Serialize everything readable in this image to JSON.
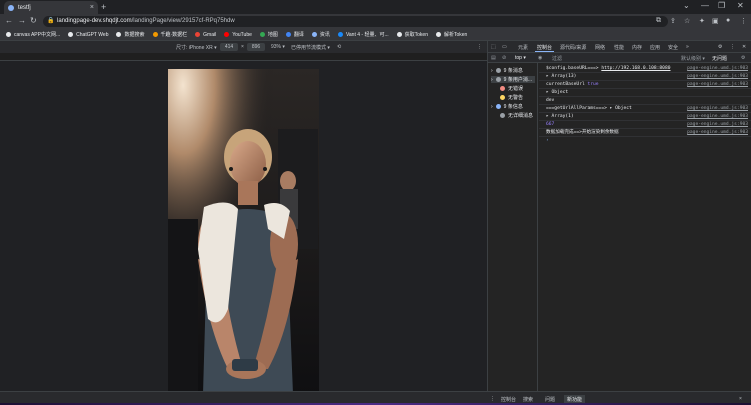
{
  "tab": {
    "title": "testfj",
    "close": "×",
    "new": "+"
  },
  "window": {
    "minimize": "⌄",
    "min2": "—",
    "max": "❐",
    "close": "✕"
  },
  "address": {
    "host": "landingpage-dev.shqdjt.com",
    "path": "/landingPage/view/29157cf-RPq75hdw"
  },
  "bookmarks": [
    {
      "label": "canvas APP中文网...",
      "color": "#e8eaed"
    },
    {
      "label": "ChatGPT Web",
      "color": "#e8eaed"
    },
    {
      "label": "数据搜索",
      "color": "#e8eaed"
    },
    {
      "label": "千趣·数据栏",
      "color": "#f29900"
    },
    {
      "label": "Gmail",
      "color": "#ea4335"
    },
    {
      "label": "YouTube",
      "color": "#ff0000"
    },
    {
      "label": "地图",
      "color": "#34a853"
    },
    {
      "label": "翻译",
      "color": "#4285f4"
    },
    {
      "label": "资讯",
      "color": "#8ab4f8"
    },
    {
      "label": "Vant 4 - 轻量、可...",
      "color": "#1989fa"
    },
    {
      "label": "获取Token",
      "color": "#e8eaed"
    },
    {
      "label": "解析Token",
      "color": "#e8eaed"
    }
  ],
  "device": {
    "label": "尺寸: iPhone XR ▾",
    "width": "414",
    "times": "×",
    "height": "896",
    "zoom": "93% ▾",
    "throttle": "已停用节流模式 ▾"
  },
  "devtools": {
    "tabs": [
      "元素",
      "控制台",
      "源代码/来源",
      "网络",
      "性能",
      "内存",
      "应用",
      "安全",
      "»"
    ],
    "active_tab": "控制台",
    "filter": {
      "context": "top ▾",
      "placeholder": "过滤",
      "levels": "默认级别 ▾",
      "issues": "无问题"
    },
    "sidebar": [
      {
        "label": "9 条消息",
        "color": "#9aa0a6"
      },
      {
        "label": "9 条用户消...",
        "color": "#9aa0a6"
      },
      {
        "label": "无错误",
        "color": "#f28b82"
      },
      {
        "label": "无警告",
        "color": "#fdd663"
      },
      {
        "label": "9 条信息",
        "color": "#8ab4f8"
      },
      {
        "label": "无详细消息",
        "color": "#9aa0a6"
      }
    ],
    "console": [
      {
        "text": "$config.baseURL===> ",
        "link": "http://192.168.0.108:8080",
        "src": "page-engine.umd.js:903"
      },
      {
        "text": "▸ Array(13)",
        "src": "page-engine.umd.js:903"
      },
      {
        "text": "currentBaseUrl ",
        "kw": "true",
        "src": "page-engine.umd.js:903"
      },
      {
        "text": "▸ Object",
        "src": ""
      },
      {
        "text": "dev",
        "src": ""
      },
      {
        "text": "===getUrlAllParams===> ▸ Object",
        "src": "page-engine.umd.js:903"
      },
      {
        "text": "▸ Array(1)",
        "src": "page-engine.umd.js:903"
      },
      {
        "text": "",
        "num": "667",
        "src": "page-engine.umd.js:903"
      },
      {
        "text": "数据加载完成==>开始渲染剩余数据",
        "src": "page-engine.umd.js:903"
      },
      {
        "text": "›",
        "src": ""
      }
    ]
  },
  "drawer": {
    "tabs": [
      "控制台",
      "搜索",
      "问题",
      "新功能"
    ],
    "active": "新功能",
    "close": "×"
  }
}
